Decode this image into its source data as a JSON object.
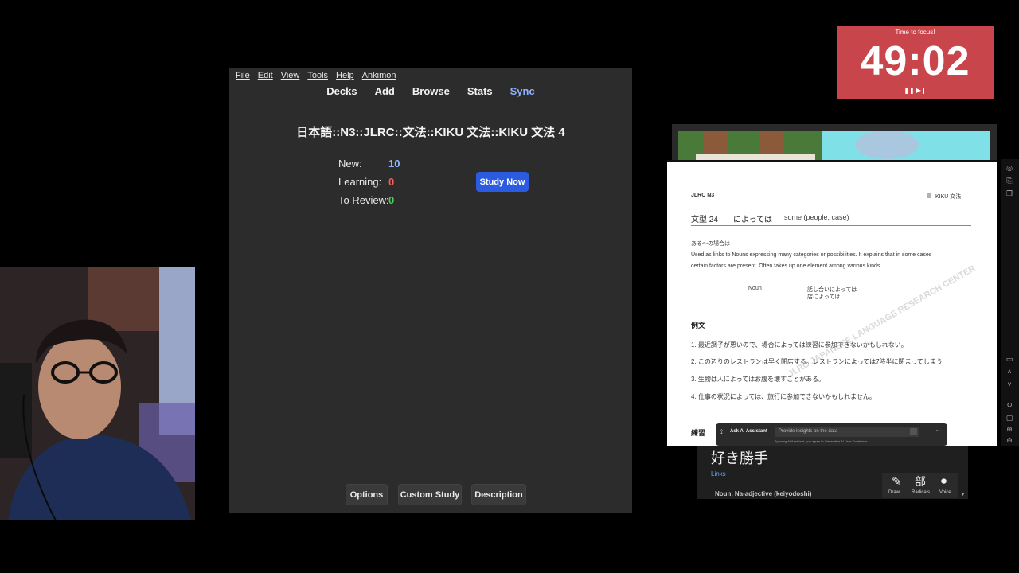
{
  "anki": {
    "menu": [
      "File",
      "Edit",
      "View",
      "Tools",
      "Help",
      "Ankimon"
    ],
    "toolbar": {
      "decks": "Decks",
      "add": "Add",
      "browse": "Browse",
      "stats": "Stats",
      "sync": "Sync"
    },
    "deck_title": "日本語::N3::JLRC::文法::KIKU 文法::KIKU 文法 4",
    "stats": {
      "new_label": "New:",
      "new_value": "10",
      "learning_label": "Learning:",
      "learning_value": "0",
      "review_label": "To Review:",
      "review_value": "0"
    },
    "study_now": "Study Now",
    "buttons": {
      "options": "Options",
      "custom_study": "Custom Study",
      "description": "Description"
    },
    "colors": {
      "new": "#8fb8ff",
      "learning": "#f05f5f",
      "review": "#4ecf5b"
    }
  },
  "timer": {
    "label": "Time to focus!",
    "value": "49:02",
    "controls": "❚❚ ▶❙"
  },
  "doc": {
    "header_left": "JLRC N3",
    "header_right": "KIKU 文法",
    "pattern_number": "文型 24",
    "pattern": "によっては",
    "pattern_meaning": "some (people, case)",
    "jp_explain": "ある～の場合は",
    "explain_line1": "Used as links to Nouns expressing many categories or possibilities. It explains that in some cases",
    "explain_line2": "certain factors are present. Often takes up one element among various kinds.",
    "form_label": "Noun",
    "form_ex1": "話し合いによっては",
    "form_ex2": "店によっては",
    "examples_heading": "例文",
    "examples": [
      "1. 最近調子が悪いので、場合によっては練習に参加できないかもしれない。",
      "2. この辺りのレストランは早く閉店する。レストランによっては7時半に閉まってしまう",
      "3. 生物は人によってはお腹を壊すことがある。",
      "4. 仕事の状況によっては、旅行に参加できないかもしれません。"
    ],
    "practice_heading": "練習",
    "watermark": "JLRC JAPANESE LANGUAGE RESEARCH CENTER"
  },
  "ai_bar": {
    "label": "Ask AI Assistant",
    "placeholder": "Provide insights on the data",
    "disclaimer": "By using AI Assistant, you agree to Generative AI User Guidelines."
  },
  "dict": {
    "word": "好き勝手",
    "links": "Links",
    "pos": "Noun, Na-adjective (keiyodoshi)",
    "tools": {
      "draw": "Draw",
      "radicals": "Radicals",
      "voice": "Voice",
      "radicals_glyph": "部"
    }
  }
}
